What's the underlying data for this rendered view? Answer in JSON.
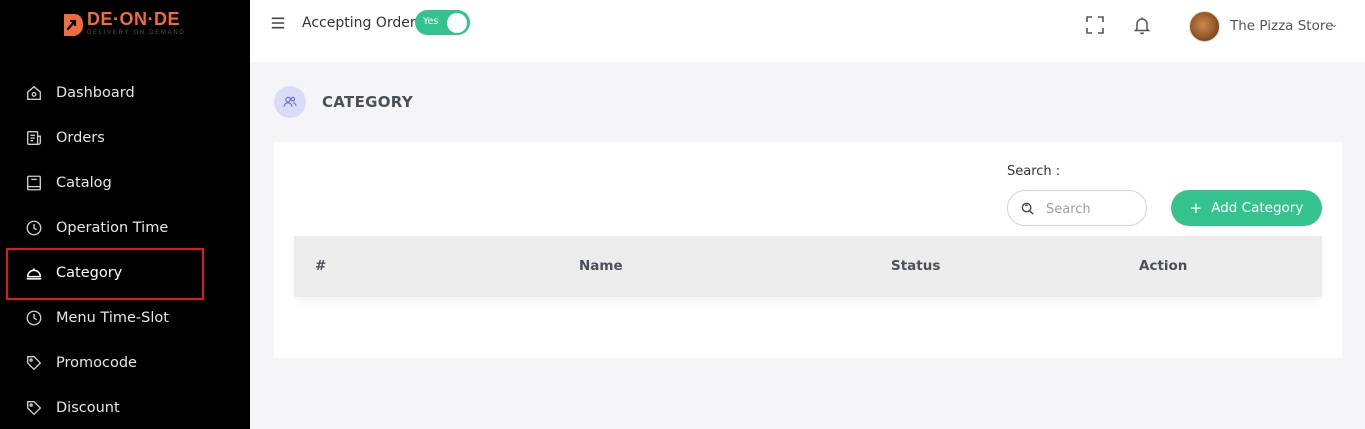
{
  "brand": {
    "name": "DE·ON·DE",
    "tagline": "DELIVERY ON DEMAND",
    "color": "#f26b3a"
  },
  "sidebar": {
    "items": [
      {
        "label": "Dashboard",
        "icon": "home-icon"
      },
      {
        "label": "Orders",
        "icon": "receipt-icon"
      },
      {
        "label": "Catalog",
        "icon": "book-icon"
      },
      {
        "label": "Operation Time",
        "icon": "clock-icon"
      },
      {
        "label": "Category",
        "icon": "cloche-icon",
        "active": true
      },
      {
        "label": "Menu Time-Slot",
        "icon": "clock-icon"
      },
      {
        "label": "Promocode",
        "icon": "tag-icon"
      },
      {
        "label": "Discount",
        "icon": "tag-icon"
      }
    ]
  },
  "header": {
    "accepting_label": "Accepting Order",
    "toggle_label": "Yes",
    "toggle_on": true,
    "store_name": "The Pizza Store"
  },
  "page": {
    "title": "CATEGORY"
  },
  "card": {
    "search_label": "Search :",
    "search_placeholder": "Search",
    "search_value": "",
    "add_button_label": "Add Category",
    "columns": [
      "#",
      "Name",
      "Status",
      "Action"
    ]
  },
  "colors": {
    "accent_green": "#34c38f",
    "sidebar_bg": "#000000",
    "active_outline": "#e0191c"
  }
}
